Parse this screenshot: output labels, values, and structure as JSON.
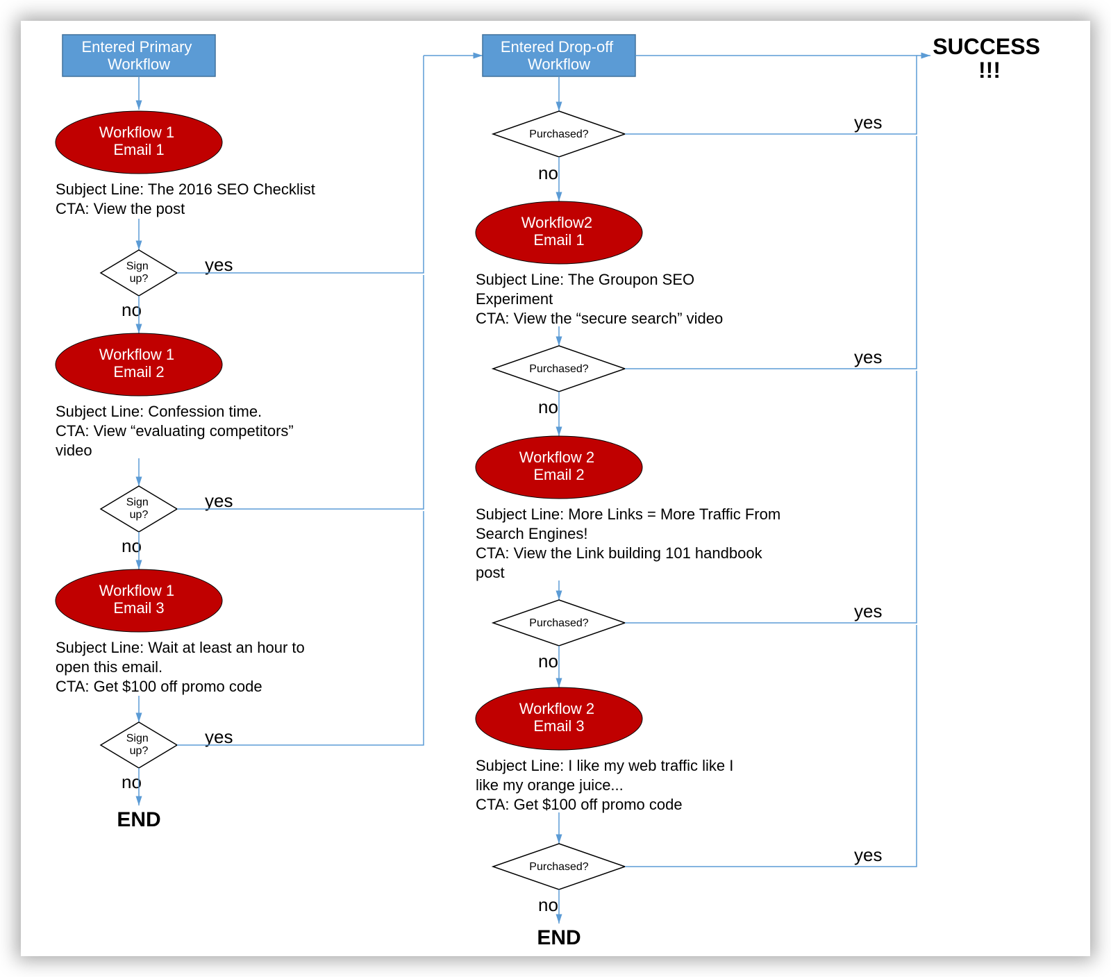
{
  "headers": {
    "primary": "Entered Primary\nWorkflow",
    "dropoff": "Entered Drop-off\nWorkflow",
    "success": "SUCCESS\n!!!"
  },
  "workflow1": {
    "email1": {
      "title": "Workflow 1\nEmail 1",
      "subject": "Subject Line: The 2016 SEO Checklist",
      "cta": "CTA: View the post"
    },
    "email2": {
      "title": "Workflow 1\nEmail 2",
      "subject": "Subject Line: Confession time.",
      "cta": "CTA: View “evaluating competitors”\nvideo"
    },
    "email3": {
      "title": "Workflow 1\nEmail 3",
      "subject": "Subject Line: Wait at least an hour to\nopen this email.",
      "cta": "CTA: Get $100 off promo code"
    },
    "decision": "Sign\nup?"
  },
  "workflow2": {
    "email1": {
      "title": "Workflow2\nEmail 1",
      "subject": "Subject Line: The Groupon SEO\nExperiment",
      "cta": "CTA: View the “secure search” video"
    },
    "email2": {
      "title": "Workflow 2\nEmail 2",
      "subject": "Subject Line: More Links = More Traffic From\nSearch Engines!",
      "cta": "CTA: View the Link building 101 handbook\npost"
    },
    "email3": {
      "title": "Workflow 2\nEmail 3",
      "subject": "Subject Line: I like my web traffic like I\nlike my orange juice...",
      "cta": "CTA: Get $100 off promo code"
    },
    "decision": "Purchased?"
  },
  "labels": {
    "yes": "yes",
    "no": "no",
    "end": "END"
  }
}
